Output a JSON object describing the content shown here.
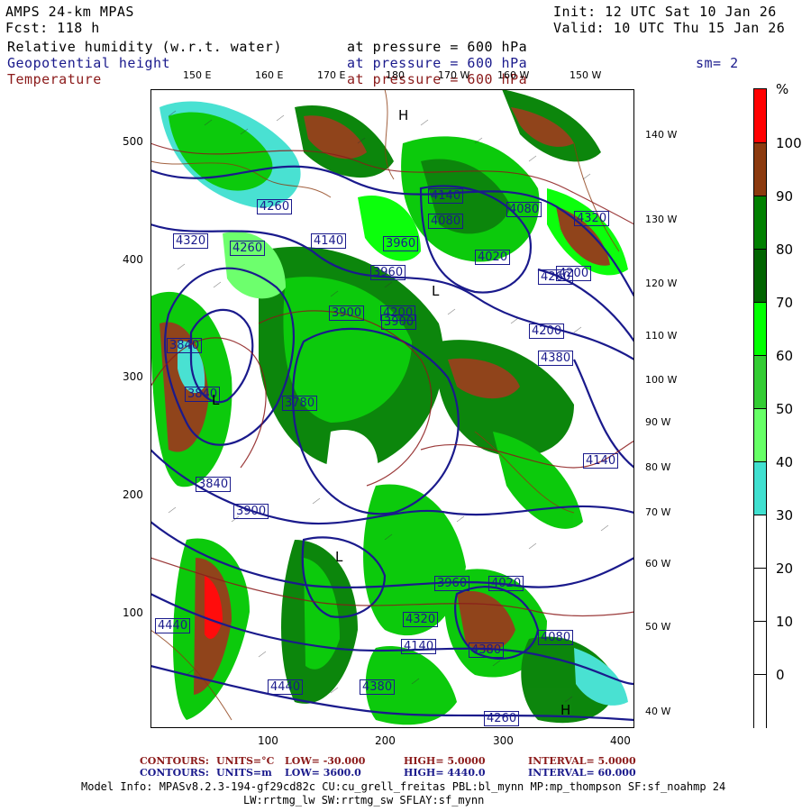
{
  "header": {
    "model": "AMPS 24-km MPAS",
    "init": "Init: 12 UTC Sat 10 Jan 26",
    "forecast": "Fcst:  118 h",
    "valid": "Valid: 10 UTC Thu 15 Jan 26"
  },
  "fields": [
    {
      "name": "Relative humidity (w.r.t. water)",
      "level": "at pressure =  600 hPa",
      "color": "#000000"
    },
    {
      "name": "Geopotential height",
      "level": "at pressure =  600 hPa",
      "color": "#1a1a8c"
    },
    {
      "name": "Temperature",
      "level": "at pressure =  600 hPa",
      "color": "#8b1a1a"
    }
  ],
  "smoothing": "sm= 2",
  "axes": {
    "x_ticks": [
      "100",
      "200",
      "300",
      "400"
    ],
    "y_ticks": [
      "500",
      "400",
      "300",
      "200",
      "100"
    ],
    "top_lon_labels": [
      "150 E",
      "160 E",
      "170 E",
      "180",
      "170 W",
      "160 W",
      "150 W"
    ],
    "right_lon_labels": [
      "140 W",
      "130 W",
      "120 W",
      "110 W",
      "100 W",
      "90 W",
      "80 W",
      "70 W",
      "60 W",
      "50 W",
      "40 W"
    ]
  },
  "colorbar": {
    "unit": "%",
    "labels": [
      "100",
      "90",
      "80",
      "70",
      "60",
      "50",
      "40",
      "30",
      "20",
      "10",
      "0"
    ],
    "segments": [
      {
        "color": "#ff0000"
      },
      {
        "color": "#8b3a0f"
      },
      {
        "color": "#008000"
      },
      {
        "color": "#006400"
      },
      {
        "color": "#00ff00"
      },
      {
        "color": "#33cc33"
      },
      {
        "color": "#66ff66"
      },
      {
        "color": "#40e0d0"
      },
      {
        "color": "#ffffff"
      },
      {
        "color": "#ffffff"
      },
      {
        "color": "#ffffff"
      },
      {
        "color": "#ffffff"
      }
    ]
  },
  "map_labels": {
    "height_boxes": [
      "4320",
      "4260",
      "4260",
      "4140",
      "3960",
      "3900",
      "3840",
      "3780",
      "3840",
      "3900",
      "3960",
      "4020",
      "4080",
      "4140",
      "4200",
      "4260",
      "4320",
      "4380",
      "4440",
      "4380",
      "4200",
      "4140",
      "4080",
      "4020",
      "3960",
      "3900",
      "3840",
      "4440",
      "4380",
      "4320",
      "4260",
      "4200",
      "4140",
      "4080"
    ],
    "extremes": [
      "H",
      "L",
      "L",
      "L",
      "H"
    ]
  },
  "footer": {
    "temp_contours": {
      "label": "CONTOURS:",
      "units": "UNITS=°C",
      "low": "LOW= -30.000",
      "high": "HIGH=  5.0000",
      "interval": "INTERVAL=   5.0000"
    },
    "height_contours": {
      "label": "CONTOURS:",
      "units": "UNITS=m",
      "low": "LOW=  3600.0",
      "high": "HIGH=  4440.0",
      "interval": "INTERVAL=   60.000"
    },
    "model_info_line1": "Model Info: MPASv8.2.3-194-gf29cd82c CU:cu_grell_freitas PBL:bl_mynn MP:mp_thompson SF:sf_noahmp 24",
    "model_info_line2": "LW:rrtmg_lw SW:rrtmg_sw SFLAY:sf_mynn"
  }
}
